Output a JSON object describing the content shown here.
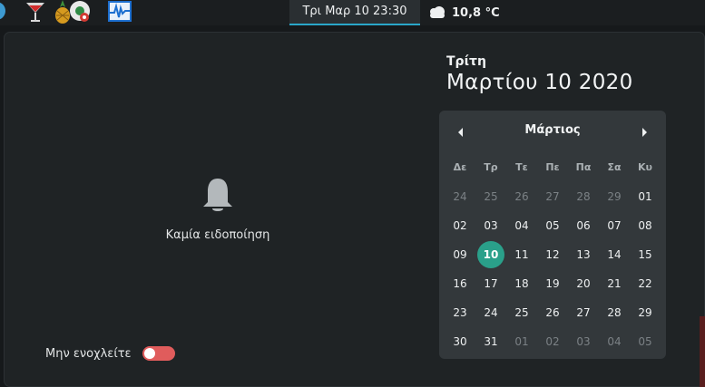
{
  "topbar": {
    "apps": [
      {
        "name": "cocktail-app-icon"
      },
      {
        "name": "pineapple-app-icon"
      },
      {
        "name": "chrome-app-icon"
      },
      {
        "name": "system-monitor-app-icon"
      }
    ],
    "clock": "Τρι Μαρ 10  23:30",
    "weather": {
      "icon": "cloudy-night-icon",
      "temp": "10,8 °C"
    }
  },
  "notifications": {
    "empty_text": "Καμία ειδοποίηση",
    "dnd_label": "Μην ενοχλείτε",
    "dnd_on": false
  },
  "date": {
    "weekday": "Τρίτη",
    "full": "Μαρτίου 10 2020"
  },
  "calendar": {
    "month": "Μάρτιος",
    "weekdays": [
      "Δε",
      "Τρ",
      "Τε",
      "Πε",
      "Πα",
      "Σα",
      "Κυ"
    ],
    "weeks": [
      [
        "24",
        "25",
        "26",
        "27",
        "28",
        "29",
        "01"
      ],
      [
        "02",
        "03",
        "04",
        "05",
        "06",
        "07",
        "08"
      ],
      [
        "09",
        "10",
        "11",
        "12",
        "13",
        "14",
        "15"
      ],
      [
        "16",
        "17",
        "18",
        "19",
        "20",
        "21",
        "22"
      ],
      [
        "23",
        "24",
        "25",
        "26",
        "27",
        "28",
        "29"
      ],
      [
        "30",
        "31",
        "01",
        "02",
        "03",
        "04",
        "05"
      ]
    ],
    "dim": [
      [
        0,
        0
      ],
      [
        0,
        1
      ],
      [
        0,
        2
      ],
      [
        0,
        3
      ],
      [
        0,
        4
      ],
      [
        0,
        5
      ],
      [
        5,
        2
      ],
      [
        5,
        3
      ],
      [
        5,
        4
      ],
      [
        5,
        5
      ],
      [
        5,
        6
      ]
    ],
    "today": [
      2,
      1
    ],
    "accent_color": "#2aa08a"
  }
}
